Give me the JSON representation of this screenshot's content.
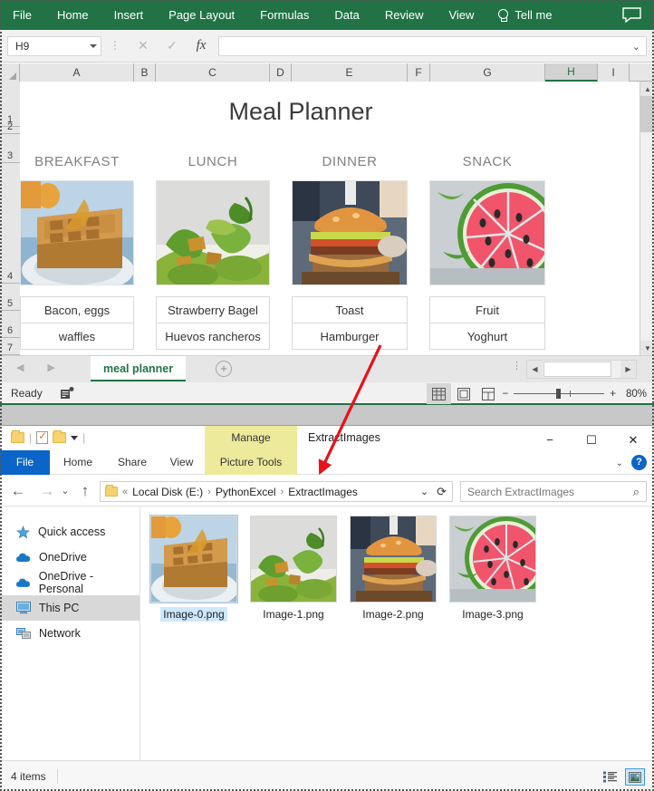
{
  "excel": {
    "ribbon_tabs": [
      "File",
      "Home",
      "Insert",
      "Page Layout",
      "Formulas",
      "Data",
      "Review",
      "View"
    ],
    "tell_me": "Tell me",
    "name_box": "H9",
    "formula_value": "",
    "column_headers": [
      "A",
      "B",
      "C",
      "D",
      "E",
      "F",
      "G",
      "H",
      "I"
    ],
    "selected_column": "H",
    "row_headers": [
      "1",
      "2",
      "3",
      "4",
      "5",
      "6",
      "7"
    ],
    "sheet_title": "Meal Planner",
    "meals": [
      {
        "header": "BREAKFAST",
        "item1": "Bacon, eggs",
        "item2": "waffles"
      },
      {
        "header": "LUNCH",
        "item1": "Strawberry Bagel",
        "item2": "Huevos rancheros"
      },
      {
        "header": "DINNER",
        "item1": "Toast",
        "item2": "Hamburger"
      },
      {
        "header": "SNACK",
        "item1": "Fruit",
        "item2": "Yoghurt"
      }
    ],
    "sheet_tab": "meal planner",
    "add_sheet_label": "+",
    "status": "Ready",
    "zoom_level": "80%",
    "zoom_minus": "−",
    "zoom_plus": "+",
    "accent_color": "#217346"
  },
  "explorer": {
    "window_title": "ExtractImages",
    "manage_tab": "Manage",
    "picture_tools": "Picture Tools",
    "ribbon_tabs": [
      "File",
      "Home",
      "Share",
      "View"
    ],
    "help_label": "?",
    "minimize": "−",
    "maximize": "☐",
    "close": "✕",
    "breadcrumb": [
      "Local Disk (E:)",
      "PythonExcel",
      "ExtractImages"
    ],
    "breadcrumb_prefix": "«",
    "breadcrumb_sep": "›",
    "search_placeholder": "Search ExtractImages",
    "nav_items": [
      {
        "label": "Quick access",
        "icon": "star-icon"
      },
      {
        "label": "OneDrive",
        "icon": "cloud-icon"
      },
      {
        "label": "OneDrive - Personal",
        "icon": "cloud-icon"
      },
      {
        "label": "This PC",
        "icon": "monitor-icon"
      },
      {
        "label": "Network",
        "icon": "network-icon"
      }
    ],
    "selected_nav": "This PC",
    "files": [
      {
        "name": "Image-0.png",
        "selected": true
      },
      {
        "name": "Image-1.png",
        "selected": false
      },
      {
        "name": "Image-2.png",
        "selected": false
      },
      {
        "name": "Image-3.png",
        "selected": false
      }
    ],
    "status_items": "4 items",
    "accent_color": "#0b64c7"
  },
  "annotation": {
    "arrow_color": "#e8111a"
  }
}
